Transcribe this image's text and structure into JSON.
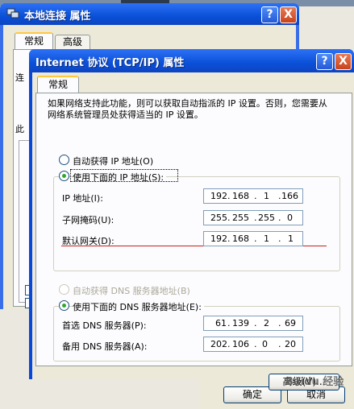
{
  "back_window": {
    "title": "本地连接 属性",
    "help_label": "?",
    "close_label": "X",
    "tabs": [
      "常规",
      "高级"
    ],
    "peek_texts": [
      "连",
      "此"
    ]
  },
  "front_window": {
    "title": "Internet 协议 (TCP/IP) 属性",
    "help_label": "?",
    "close_label": "X",
    "tab": "常规",
    "description": "如果网络支持此功能，则可以获取自动指派的 IP 设置。否则，您需要从网络系统管理员处获得适当的 IP 设置。",
    "ip_mode": {
      "auto_label": "自动获得 IP 地址(O)",
      "manual_label": "使用下面的 IP 地址(S):",
      "selected": "manual"
    },
    "ip_fields": [
      {
        "label": "IP 地址(I):",
        "octets": [
          "192",
          "168",
          "1",
          "166"
        ]
      },
      {
        "label": "子网掩码(U):",
        "octets": [
          "255",
          "255",
          "255",
          "0"
        ]
      },
      {
        "label": "默认网关(D):",
        "octets": [
          "192",
          "168",
          "1",
          "1"
        ]
      }
    ],
    "dns_mode": {
      "auto_label": "自动获得 DNS 服务器地址(B)",
      "manual_label": "使用下面的 DNS 服务器地址(E):",
      "selected": "manual"
    },
    "dns_fields": [
      {
        "label": "首选 DNS 服务器(P):",
        "octets": [
          "61",
          "139",
          "2",
          "69"
        ]
      },
      {
        "label": "备用 DNS 服务器(A):",
        "octets": [
          "202",
          "106",
          "0",
          "20"
        ]
      }
    ],
    "advanced_label": "高级(V)...",
    "ok_label": "确定",
    "cancel_label": "取消"
  },
  "watermark": "Baidu 经验",
  "colors": {
    "title_bar": "#0a50d8",
    "dialog_bg": "#ece9d8",
    "highlight_line": "#c81e1e",
    "radio_dot": "#2fa82f"
  }
}
